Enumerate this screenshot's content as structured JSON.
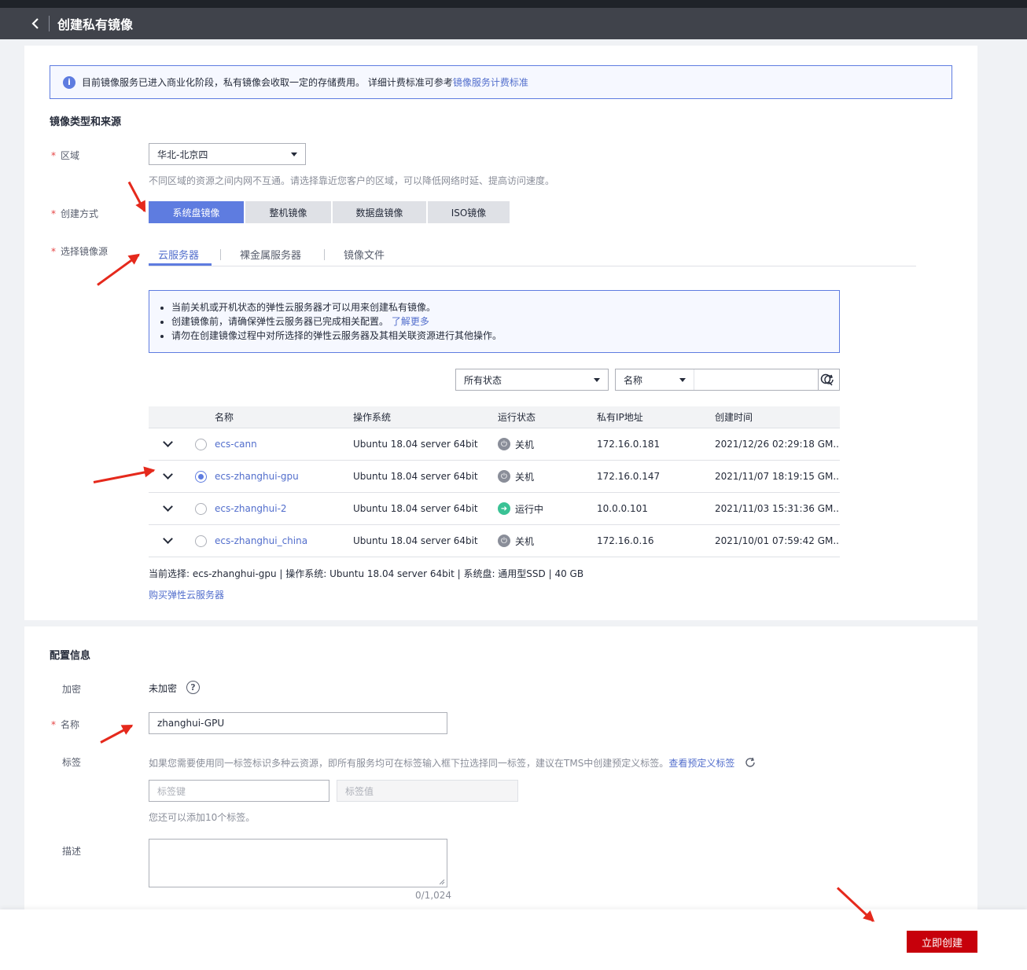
{
  "header": {
    "title": "创建私有镜像"
  },
  "notice": {
    "text": "目前镜像服务已进入商业化阶段，私有镜像会收取一定的存储费用。 详细计费标准可参考",
    "link": "镜像服务计费标准"
  },
  "source_section": {
    "title": "镜像类型和来源",
    "region": {
      "label": "区域",
      "value": "华北-北京四",
      "hint": "不同区域的资源之间内网不互通。请选择靠近您客户的区域，可以降低网络时延、提高访问速度。"
    },
    "create_method": {
      "label": "创建方式",
      "options": [
        "系统盘镜像",
        "整机镜像",
        "数据盘镜像",
        "ISO镜像"
      ],
      "selected": "系统盘镜像"
    },
    "image_source": {
      "label": "选择镜像源",
      "tabs": [
        "云服务器",
        "裸金属服务器",
        "镜像文件"
      ],
      "active_tab": "云服务器"
    },
    "notes": [
      "当前关机或开机状态的弹性云服务器才可以用来创建私有镜像。",
      "创建镜像前，请确保弹性云服务器已完成相关配置。",
      "请勿在创建镜像过程中对所选择的弹性云服务器及其相关联资源进行其他操作。"
    ],
    "notes_link": "了解更多",
    "filter": {
      "status": "所有状态",
      "field": "名称"
    },
    "table": {
      "columns": [
        "名称",
        "操作系统",
        "运行状态",
        "私有IP地址",
        "创建时间"
      ],
      "rows": [
        {
          "name": "ecs-cann",
          "os": "Ubuntu 18.04 server 64bit",
          "status": "关机",
          "ip": "172.16.0.181",
          "time": "2021/12/26 02:29:18 GM...",
          "selected": false
        },
        {
          "name": "ecs-zhanghui-gpu",
          "os": "Ubuntu 18.04 server 64bit",
          "status": "关机",
          "ip": "172.16.0.147",
          "time": "2021/11/07 18:19:15 GM...",
          "selected": true
        },
        {
          "name": "ecs-zhanghui-2",
          "os": "Ubuntu 18.04 server 64bit",
          "status": "运行中",
          "ip": "10.0.0.101",
          "time": "2021/11/03 15:31:36 GM...",
          "selected": false
        },
        {
          "name": "ecs-zhanghui_china",
          "os": "Ubuntu 18.04 server 64bit",
          "status": "关机",
          "ip": "172.16.0.16",
          "time": "2021/10/01 07:59:42 GM...",
          "selected": false
        }
      ]
    },
    "current_selection": "当前选择: ecs-zhanghui-gpu | 操作系统: Ubuntu 18.04 server 64bit | 系统盘: 通用型SSD | 40 GB",
    "buy_link": "购买弹性云服务器"
  },
  "config_section": {
    "title": "配置信息",
    "encryption": {
      "label": "加密",
      "value": "未加密"
    },
    "name": {
      "label": "名称",
      "value": "zhanghui-GPU"
    },
    "tags": {
      "label": "标签",
      "hint": "如果您需要使用同一标签标识多种云资源，即所有服务均可在标签输入框下拉选择同一标签，建议在TMS中创建预定义标签。",
      "hint_link": "查看预定义标签",
      "key_placeholder": "标签键",
      "value_placeholder": "标签值",
      "remaining": "您还可以添加10个标签。"
    },
    "description": {
      "label": "描述",
      "counter": "0/1,024"
    }
  },
  "footer": {
    "submit": "立即创建"
  },
  "colors": {
    "accent": "#5e7ce0",
    "link": "#526ecc",
    "primary_button": "#c7000b",
    "annotation_arrow": "#e5291c",
    "running": "#3ac295"
  }
}
